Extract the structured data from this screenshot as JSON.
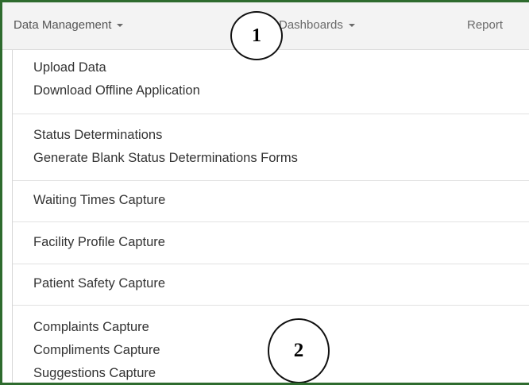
{
  "nav": {
    "data_management": "Data Management",
    "dashboards": "Dashboards",
    "reports": "Report"
  },
  "menu": {
    "upload_data": "Upload Data",
    "download_offline": "Download Offline Application",
    "status_determinations": "Status Determinations",
    "generate_blank_forms": "Generate Blank Status Determinations Forms",
    "waiting_times": "Waiting Times Capture",
    "facility_profile": "Facility Profile Capture",
    "patient_safety": "Patient Safety Capture",
    "complaints": "Complaints Capture",
    "compliments": "Compliments Capture",
    "suggestions": "Suggestions Capture"
  },
  "callouts": {
    "one": "1",
    "two": "2"
  },
  "colors": {
    "frame_border": "#2e6b2e",
    "nav_background": "#f3f3f3",
    "menu_text": "#333333"
  },
  "icons": {
    "dropdown": "caret-down-icon"
  }
}
